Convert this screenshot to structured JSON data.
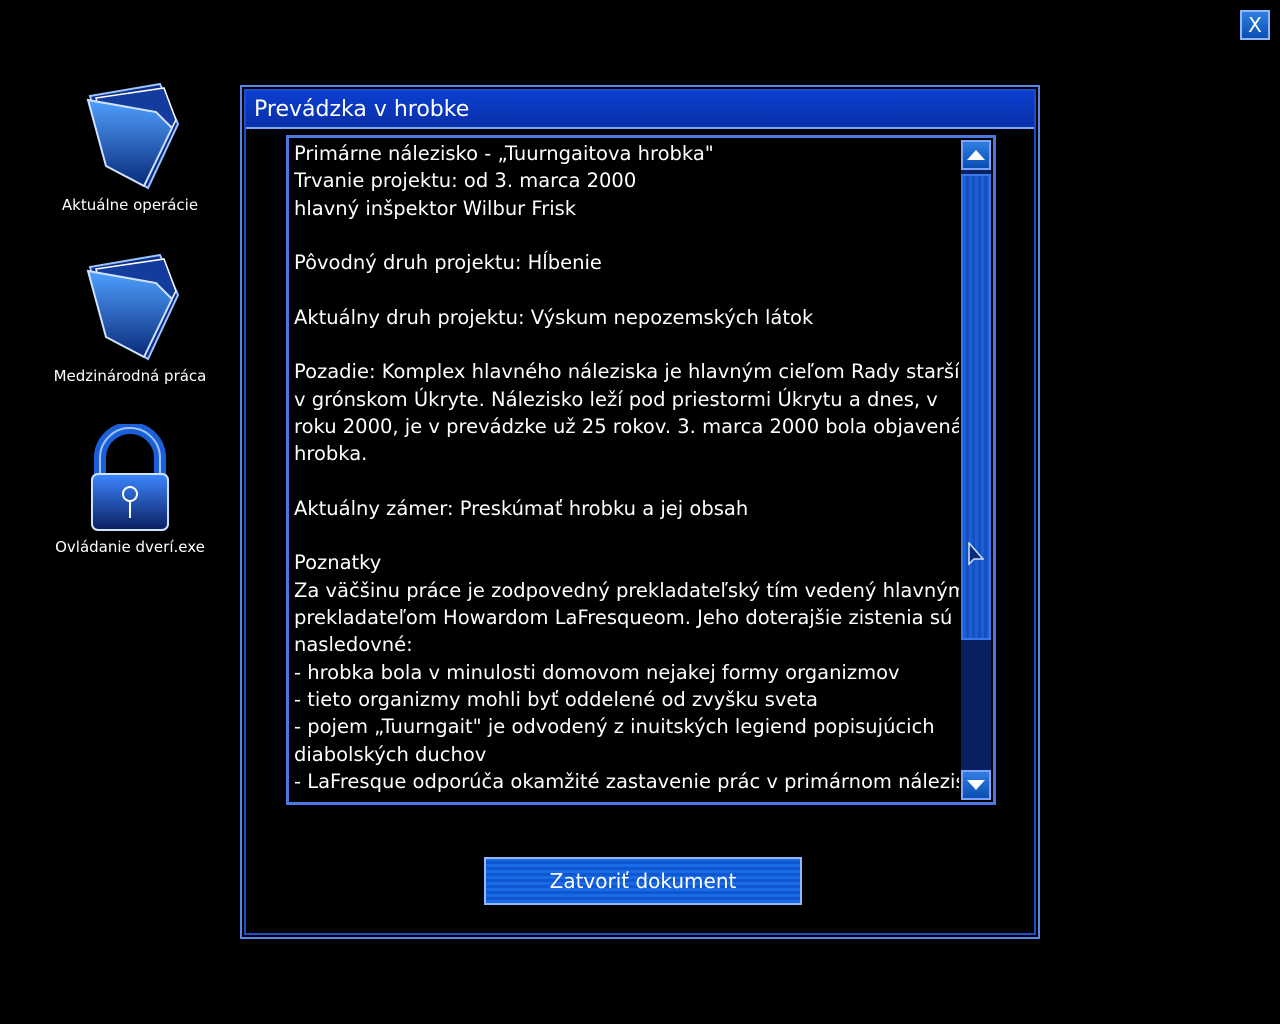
{
  "top_right": {
    "close_label": "X"
  },
  "desktop_icons": [
    {
      "label": "Aktuálne operácie",
      "icon": "folder-icon"
    },
    {
      "label": "Medzinárodná práca",
      "icon": "folder-icon"
    },
    {
      "label": "Ovládanie dverí.exe",
      "icon": "padlock-icon"
    }
  ],
  "window": {
    "title": "Prevádzka v hrobke",
    "document_lines": [
      "Primárne nálezisko - „Tuurngaitova hrobka\"",
      "Trvanie projektu: od 3. marca 2000",
      "hlavný inšpektor Wilbur Frisk",
      "",
      "Pôvodný druh projektu: Hĺbenie",
      "",
      "Aktuálny druh projektu: Výskum nepozemských látok",
      "",
      "Pozadie: Komplex hlavného náleziska je hlavným cieľom Rady starších",
      "v grónskom Úkryte. Nálezisko leží pod priestormi Úkrytu a dnes, v",
      "roku 2000, je v prevádzke už 25 rokov. 3. marca 2000 bola objavená",
      "hrobka.",
      "",
      "Aktuálny zámer: Preskúmať hrobku a jej obsah",
      "",
      "Poznatky",
      "Za väčšinu práce je zodpovedný prekladateľský tím vedený hlavným",
      "prekladateľom Howardom LaFresqueom. Jeho doterajšie zistenia sú",
      "nasledovné:",
      "- hrobka bola v minulosti domovom nejakej formy organizmov",
      "- tieto organizmy mohli byť oddelené od zvyšku sveta",
      "- pojem „Tuurngait\" je odvodený z inuitských legiend popisujúcich",
      "diabolských duchov",
      "- LaFresque odporúča okamžité zastavenie prác v primárnom nálezisku"
    ],
    "close_doc_label": "Zatvoriť dokument",
    "scroll": {
      "position_fraction": 0.0,
      "visible_fraction": 0.72
    }
  },
  "colors": {
    "accent": "#0f57d0",
    "border": "#4b78e0",
    "background": "#000000"
  }
}
